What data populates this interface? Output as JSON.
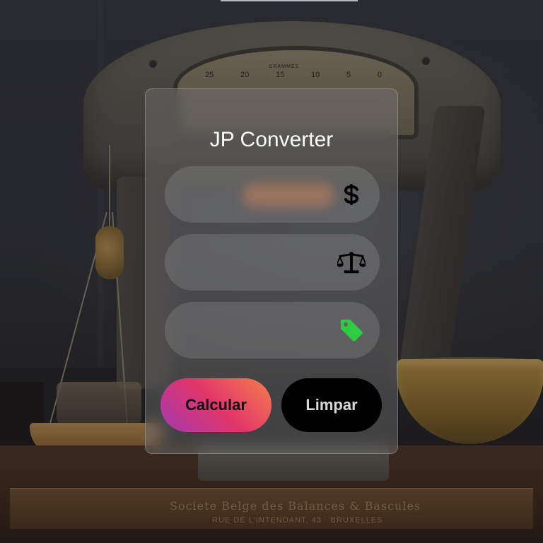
{
  "app": {
    "title": "JP Converter"
  },
  "fields": [
    {
      "name": "price",
      "value": "",
      "placeholder": "",
      "icon": "dollar-icon",
      "icon_color": "#000000"
    },
    {
      "name": "weight",
      "value": "",
      "placeholder": "",
      "icon": "balance-scale-icon",
      "icon_color": "#000000"
    },
    {
      "name": "result",
      "value": "",
      "placeholder": "",
      "icon": "tag-icon",
      "icon_color": "#2ecc40"
    }
  ],
  "buttons": {
    "calculate_label": "Calcular",
    "clear_label": "Limpar"
  },
  "colors": {
    "calculate_gradient": [
      "#a23ab0",
      "#e2356a",
      "#f37f4c"
    ],
    "clear_bg": "#000000",
    "tag_icon": "#2ecc40"
  },
  "background": {
    "bench_text": "Societe Belge des Balances & Bascules",
    "bench_subtext": "RUE DE L'INTENDANT, 43 · BRUXELLES",
    "dial_label": "GRAMMES",
    "dial_ticks": [
      "25",
      "20",
      "15",
      "10",
      "5",
      "0"
    ]
  }
}
